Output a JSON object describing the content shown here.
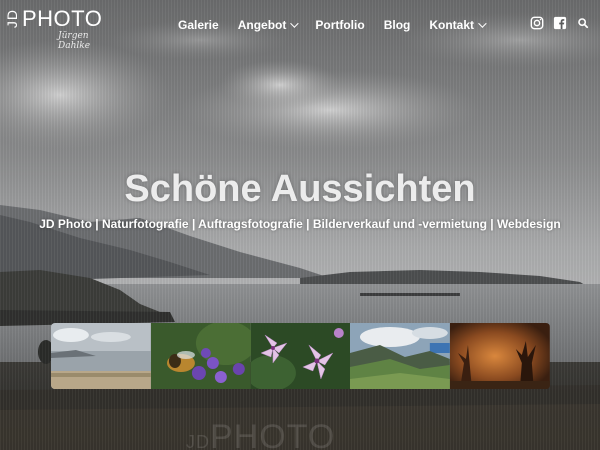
{
  "header": {
    "logo": {
      "jd": "JD",
      "photo": "PHOTO",
      "signature": "Jürgen Dahlke"
    },
    "nav": [
      {
        "label": "Galerie",
        "has_dropdown": false
      },
      {
        "label": "Angebot",
        "has_dropdown": true
      },
      {
        "label": "Portfolio",
        "has_dropdown": false
      },
      {
        "label": "Blog",
        "has_dropdown": false
      },
      {
        "label": "Kontakt",
        "has_dropdown": true
      }
    ],
    "social_icons": [
      "instagram-icon",
      "facebook-icon",
      "search-icon"
    ]
  },
  "hero": {
    "title": "Schöne Aussichten",
    "subtitle": "JD Photo | Naturfotografie | Auftragsfotografie | Bilderverkauf und -vermietung | Webdesign"
  },
  "gallery": {
    "thumbnails": [
      {
        "subject": "coastal landscape"
      },
      {
        "subject": "bee on lavender"
      },
      {
        "subject": "pink lily flowers"
      },
      {
        "subject": "green valley with clouds"
      },
      {
        "subject": "orange tree at night"
      }
    ]
  },
  "watermark": {
    "jd": "JD",
    "photo": "PHOTO"
  },
  "colors": {
    "text": "#ffffff",
    "background": "#3f4143"
  }
}
